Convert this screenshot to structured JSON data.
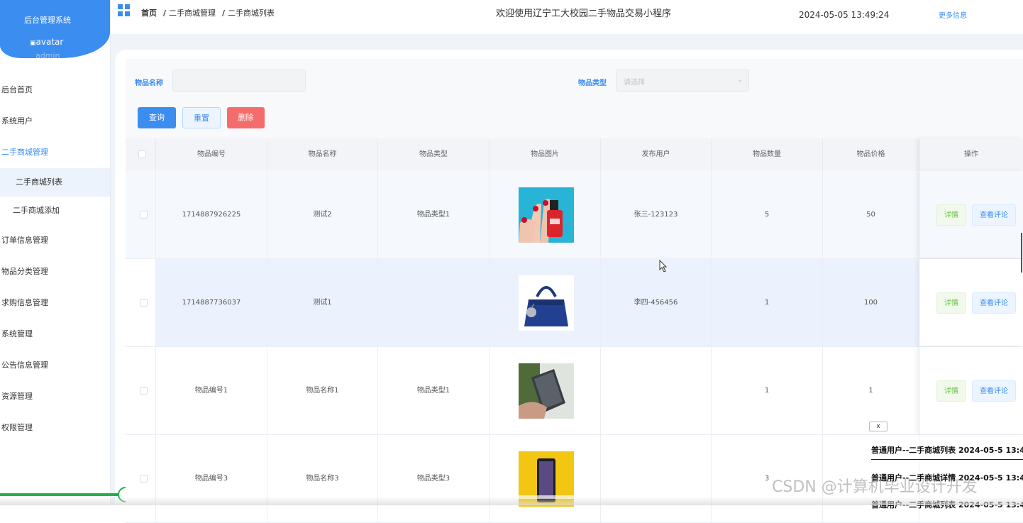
{
  "sidebar": {
    "system_title": "后台管理系统",
    "avatar_alt": "avatar",
    "username": "admin",
    "menu": [
      {
        "label": "后台首页"
      },
      {
        "label": "系统用户"
      },
      {
        "label": "二手商城管理",
        "active": true
      }
    ],
    "sub_menu": [
      {
        "label": "二手商城列表",
        "active": true
      },
      {
        "label": "二手商城添加"
      }
    ],
    "menu_rest": [
      {
        "label": "订单信息管理"
      },
      {
        "label": "物品分类管理"
      },
      {
        "label": "求购信息管理"
      },
      {
        "label": "系统管理"
      },
      {
        "label": "公告信息管理"
      },
      {
        "label": "资源管理"
      },
      {
        "label": "权限管理"
      }
    ]
  },
  "header": {
    "breadcrumb": [
      "首页",
      "二手商城管理",
      "二手商城列表"
    ],
    "welcome": "欢迎使用辽宁工大校园二手物品交易小程序",
    "datetime": "2024-05-05 13:49:24",
    "more_info": "更多信息"
  },
  "filters": {
    "name_label": "物品名称",
    "name_value": "",
    "type_label": "物品类型",
    "type_placeholder": "请选择",
    "query_button": "查询",
    "reset_button": "重置",
    "delete_button": "删除"
  },
  "table": {
    "columns": [
      "物品编号",
      "物品名称",
      "物品类型",
      "物品图片",
      "发布用户",
      "物品数量",
      "物品价格",
      "操作"
    ],
    "rows": [
      {
        "id": "1714887926225",
        "name": "测试2",
        "type": "物品类型1",
        "image": "nail-polish-photo",
        "user": "张三-123123",
        "qty": "5",
        "price": "50"
      },
      {
        "id": "1714887736037",
        "name": "测试1",
        "type": "",
        "image": "handbag-photo",
        "user": "李四-456456",
        "qty": "1",
        "price": "100"
      },
      {
        "id": "物品编号1",
        "name": "物品名称1",
        "type": "物品类型1",
        "image": "phone-in-hand-photo",
        "user": "",
        "qty": "1",
        "price": "1"
      },
      {
        "id": "物品编号3",
        "name": "物品名称3",
        "type": "物品类型3",
        "image": "smartphone-yellow-photo",
        "user": "",
        "qty": "3",
        "price": ""
      }
    ],
    "detail_button": "详情",
    "comment_button": "查看评论"
  },
  "notification": {
    "close_label": "x",
    "entries": [
      "普通用户--二手商城列表 2024-05-5 13:4",
      "普通用户--二手商城详情 2024-05-5 13:4",
      "普通用户--二手商城列表 2024-05-5 13:4"
    ]
  },
  "watermark": "CSDN @计算机毕业设计开发",
  "colors": {
    "primary": "#3c8df0",
    "danger": "#f56c6c",
    "success": "#67c23a",
    "progress": "#22b14c"
  }
}
